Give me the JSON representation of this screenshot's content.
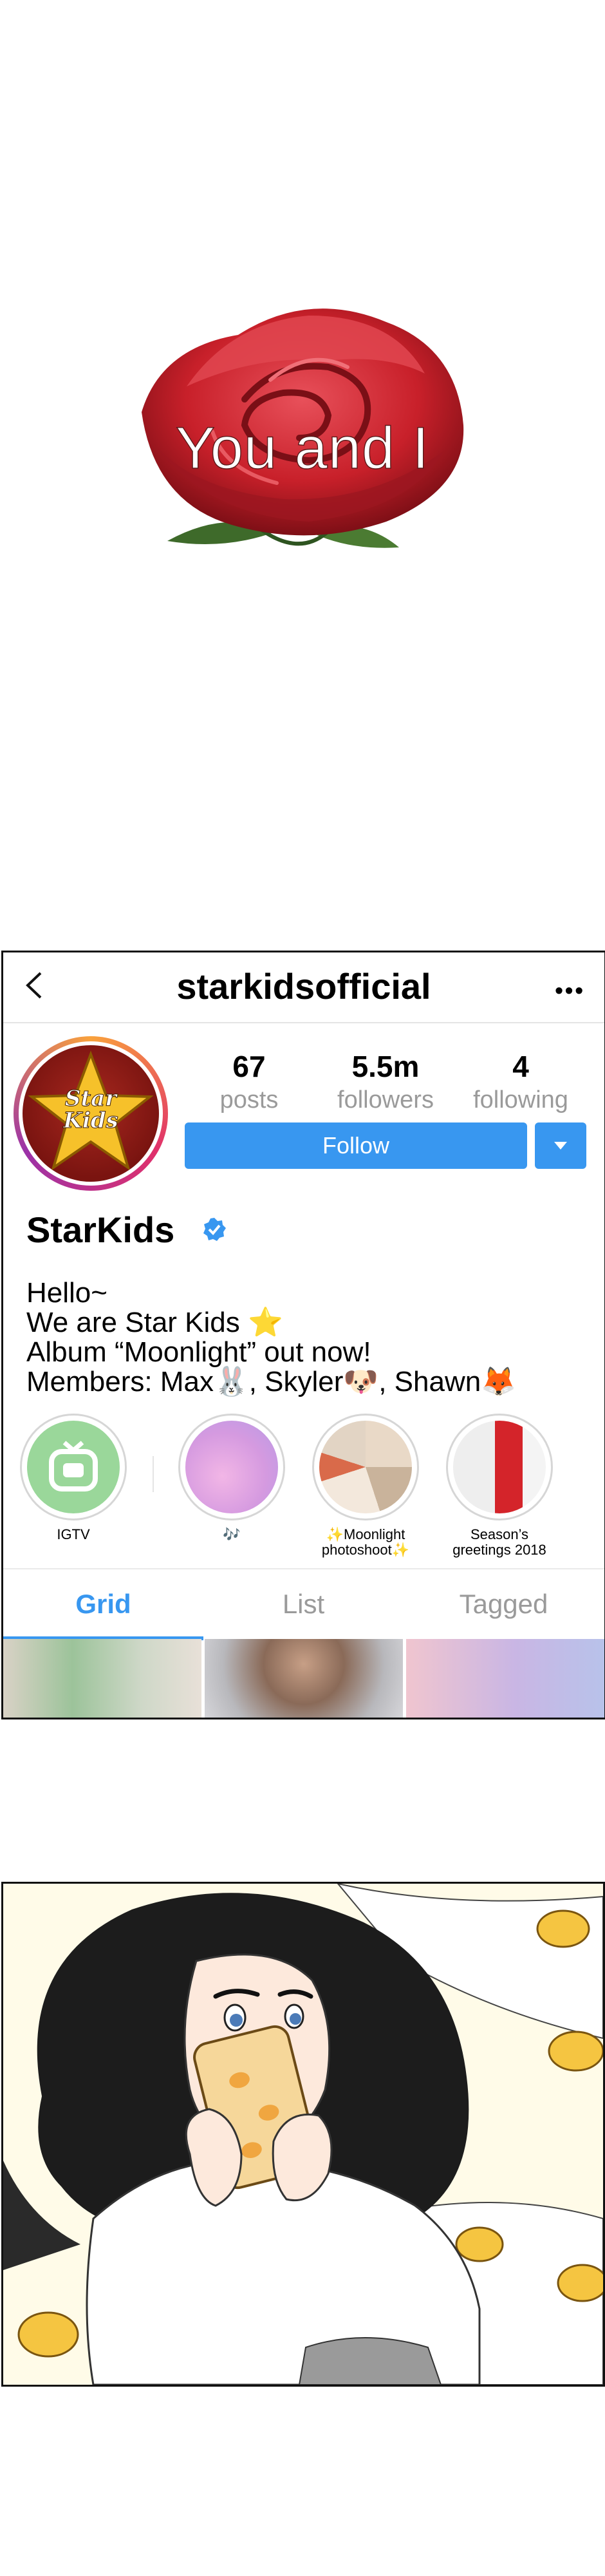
{
  "title_panel": {
    "title": "You and I"
  },
  "profile": {
    "username": "starkidsofficial",
    "avatar_text": [
      "Star",
      "Kids"
    ],
    "stats": [
      {
        "value": "67",
        "label": "posts"
      },
      {
        "value": "5.5m",
        "label": "followers"
      },
      {
        "value": "4",
        "label": "following"
      }
    ],
    "follow_label": "Follow",
    "display_name": "StarKids",
    "bio": [
      "Hello~",
      "We are Star Kids ⭐",
      "Album “Moonlight” out now!",
      "Members: Max🐰, Skyler🐶, Shawn🦊"
    ],
    "highlights": [
      {
        "label": "IGTV"
      },
      {
        "label": "🎶"
      },
      {
        "label": "✨Moonlight photoshoot✨"
      },
      {
        "label": "Season’s greetings 2018"
      }
    ],
    "tabs": [
      "Grid",
      "List",
      "Tagged"
    ],
    "active_tab": "Grid"
  },
  "colors": {
    "accent": "#3897f0",
    "avatar_ring": [
      "#f9a23c",
      "#e0306b",
      "#9b32a8"
    ],
    "rose": "#c8202a"
  },
  "icons": [
    "back-chevron-icon",
    "more-options-icon",
    "dropdown-arrow-icon",
    "verified-badge-icon",
    "igtv-icon"
  ]
}
